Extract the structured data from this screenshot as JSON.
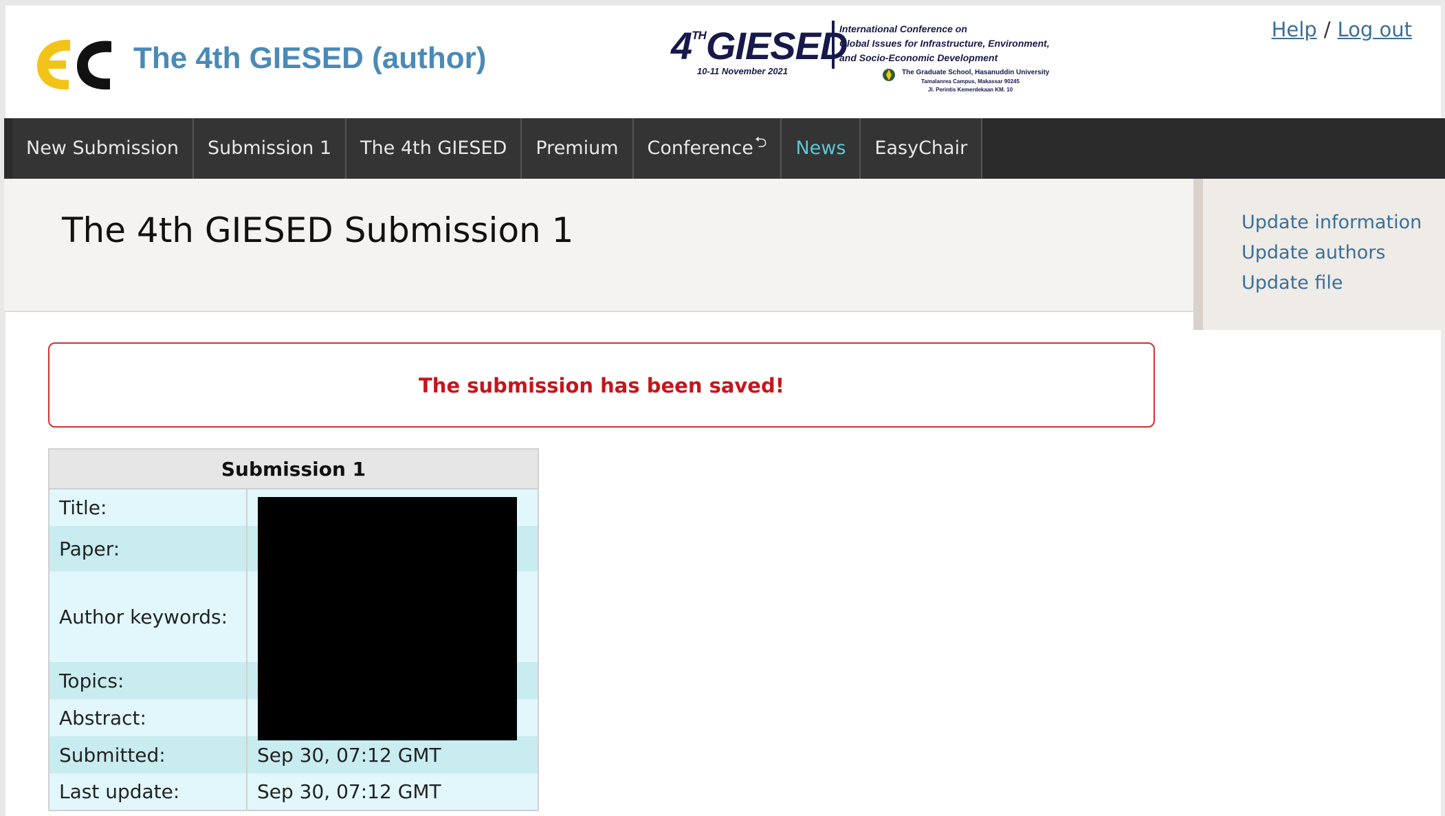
{
  "app": {
    "title": "The 4th GIESED (author)"
  },
  "banner": {
    "big": "4",
    "sup": "TH",
    "name": "GIESED",
    "dates": "10-11 November 2021",
    "lines": [
      "International Conference on",
      "Global Issues for Infrastructure, Environment,",
      "and Socio-Economic Development"
    ],
    "school": "The Graduate School, Hasanuddin University",
    "address1": "Tamalanrea Campus, Makassar 90245",
    "address2": "Jl. Perintis Kemerdekaan KM. 10"
  },
  "top_links": {
    "help": "Help",
    "separator": "/",
    "logout": "Log out"
  },
  "nav": {
    "items": [
      {
        "label": "New Submission"
      },
      {
        "label": "Submission 1"
      },
      {
        "label": "The 4th GIESED"
      },
      {
        "label": "Premium"
      },
      {
        "label": "Conference",
        "glyph": "⮌"
      },
      {
        "label": "News"
      },
      {
        "label": "EasyChair"
      }
    ],
    "active_index": 5
  },
  "page": {
    "title": "The 4th GIESED Submission 1"
  },
  "side_menu": {
    "items": [
      {
        "label": "Update information"
      },
      {
        "label": "Update authors"
      },
      {
        "label": "Update file"
      }
    ]
  },
  "message": {
    "text": "The submission has been saved!"
  },
  "submission": {
    "header": "Submission 1",
    "rows": [
      {
        "label": "Title:",
        "value": ""
      },
      {
        "label": "Paper:",
        "value": ""
      },
      {
        "label": "Author keywords:",
        "value": ""
      },
      {
        "label": "Topics:",
        "value": ""
      },
      {
        "label": "Abstract:",
        "value": ""
      },
      {
        "label": "Submitted:",
        "value": "Sep 30, 07:12 GMT"
      },
      {
        "label": "Last update:",
        "value": "Sep 30, 07:12 GMT"
      }
    ]
  },
  "colors": {
    "title_blue": "#4a8ab7",
    "link_blue": "#3a6f99",
    "nav_bg": "#2b2b2b",
    "nav_active": "#5ac8da",
    "message_red": "#c4161c",
    "logo_yellow": "#f2c418"
  },
  "icons": {
    "logo": "easychair-logo-icon",
    "seal": "university-seal-icon",
    "return": "return-arrow-icon"
  }
}
